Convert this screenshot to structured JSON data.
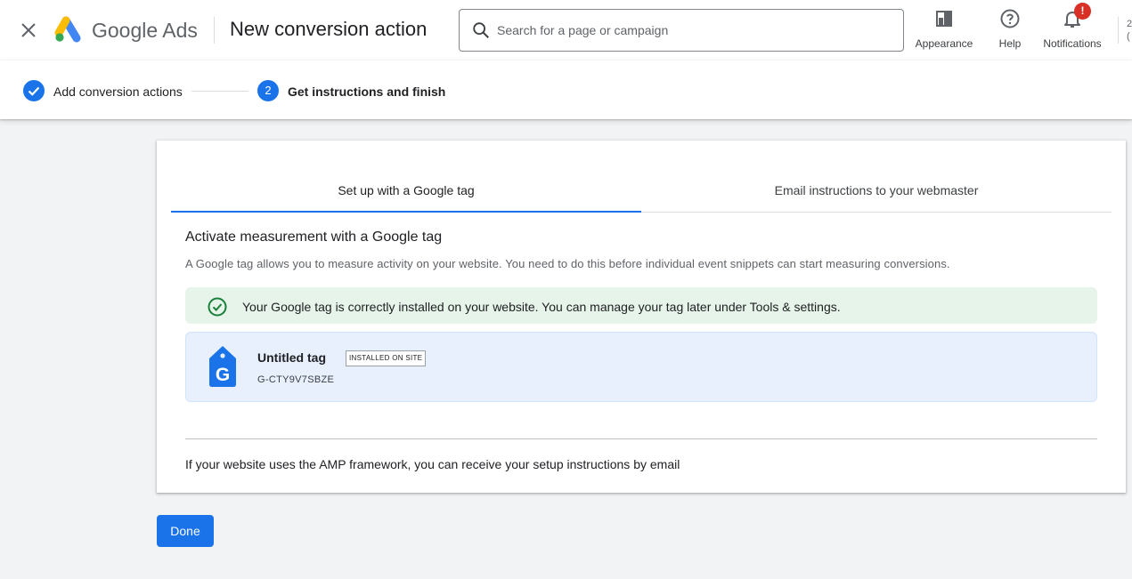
{
  "app": {
    "brand_google": "Google",
    "brand_ads": "Ads",
    "page_title": "New conversion action"
  },
  "search": {
    "placeholder": "Search for a page or campaign",
    "icon": "search-icon"
  },
  "toolbar": {
    "appearance_label": "Appearance",
    "help_label": "Help",
    "notifications_label": "Notifications",
    "notification_badge": "!",
    "edge_fragment_top": "2",
    "edge_fragment_bottom": "("
  },
  "stepper": {
    "step1_label": "Add conversion actions",
    "step2_number": "2",
    "step2_label": "Get instructions and finish"
  },
  "tabs": [
    {
      "label": "Set up with a Google tag",
      "selected": true
    },
    {
      "label": "Email instructions to your webmaster",
      "selected": false
    }
  ],
  "section": {
    "title": "Activate measurement with a Google tag",
    "description": "A Google tag allows you to measure activity on your website. You need to do this before individual event snippets can start measuring conversions."
  },
  "success_message": "Your Google tag is correctly installed on your website. You can manage your tag later under Tools & settings.",
  "tag": {
    "name": "Untitled tag",
    "status_badge": "INSTALLED ON SITE",
    "id": "G-CTY9V7SBZE"
  },
  "amp_note": "If your website uses the AMP framework, you can receive your setup instructions by email",
  "done_label": "Done",
  "colors": {
    "primary": "#1a73e8",
    "success_bg": "#e6f4ea",
    "success_icon": "#188038",
    "tag_bg": "#e8f0fe",
    "alert": "#d93025"
  }
}
